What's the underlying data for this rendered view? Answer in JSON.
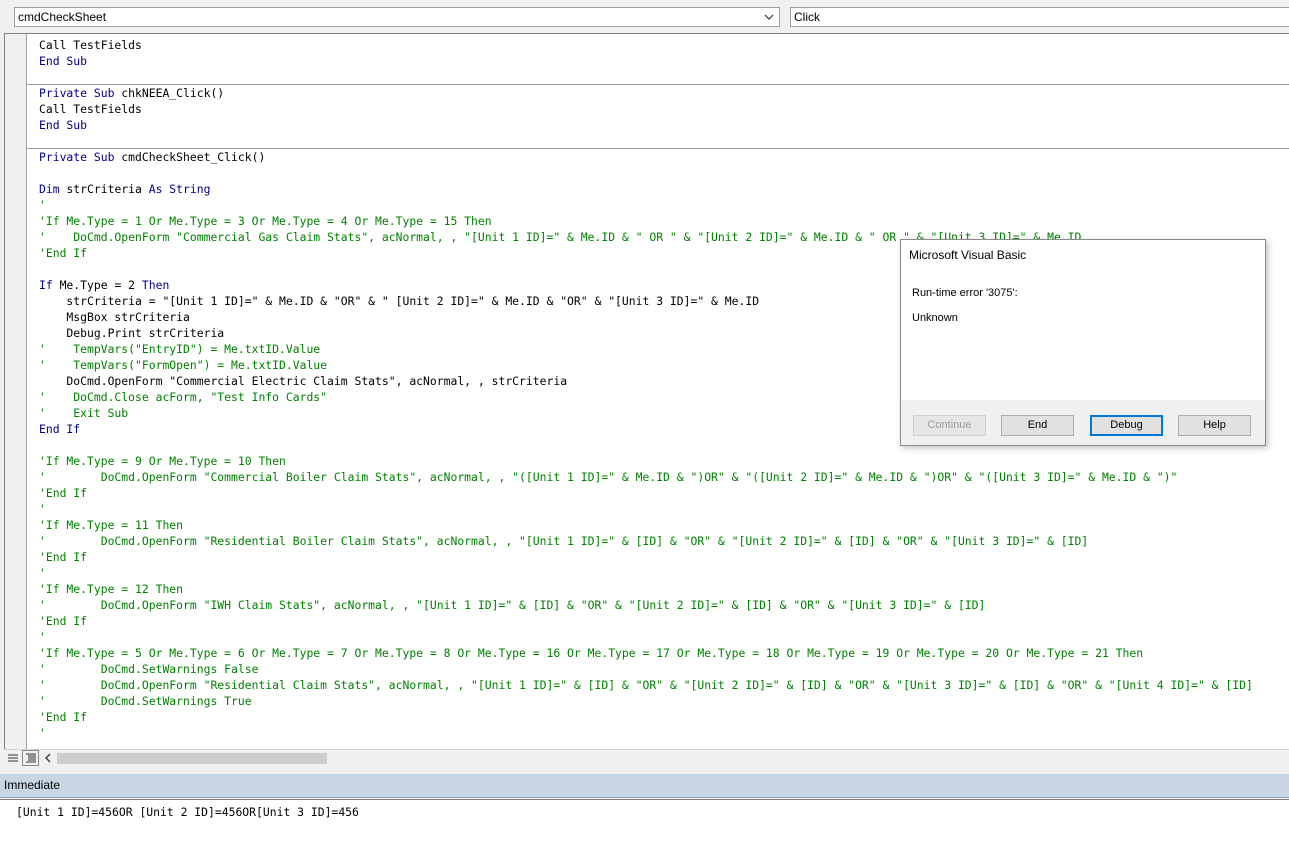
{
  "toolbar": {
    "object_combo": "cmdCheckSheet",
    "procedure_combo": "Click"
  },
  "code_lines": [
    [
      [
        "p",
        "Call TestFields"
      ]
    ],
    [
      [
        "k",
        "End Sub"
      ]
    ],
    [],
    [
      [
        "k",
        "Private Sub "
      ],
      [
        "p",
        "chkNEEA_Click()"
      ]
    ],
    [
      [
        "p",
        "Call TestFields"
      ]
    ],
    [
      [
        "k",
        "End Sub"
      ]
    ],
    [],
    [
      [
        "k",
        "Private Sub "
      ],
      [
        "p",
        "cmdCheckSheet_Click()"
      ]
    ],
    [],
    [
      [
        "k",
        "Dim "
      ],
      [
        "p",
        "strCriteria "
      ],
      [
        "k",
        "As String"
      ]
    ],
    [
      [
        "c",
        "'"
      ]
    ],
    [
      [
        "c",
        "'If Me.Type = 1 Or Me.Type = 3 Or Me.Type = 4 Or Me.Type = 15 Then"
      ]
    ],
    [
      [
        "c",
        "'    DoCmd.OpenForm \"Commercial Gas Claim Stats\", acNormal, , \"[Unit 1 ID]=\" & Me.ID & \" OR \" & \"[Unit 2 ID]=\" & Me.ID & \" OR \" & \"[Unit 3 ID]=\" & Me.ID"
      ]
    ],
    [
      [
        "c",
        "'End If"
      ]
    ],
    [],
    [
      [
        "k",
        "If "
      ],
      [
        "p",
        "Me.Type = 2 "
      ],
      [
        "k",
        "Then"
      ]
    ],
    [
      [
        "p",
        "    strCriteria = \"[Unit 1 ID]=\" & Me.ID & \"OR\" & \" [Unit 2 ID]=\" & Me.ID & \"OR\" & \"[Unit 3 ID]=\" & Me.ID"
      ]
    ],
    [
      [
        "p",
        "    MsgBox strCriteria"
      ]
    ],
    [
      [
        "p",
        "    Debug.Print strCriteria"
      ]
    ],
    [
      [
        "c",
        "'    TempVars(\"EntryID\") = Me.txtID.Value"
      ]
    ],
    [
      [
        "c",
        "'    TempVars(\"FormOpen\") = Me.txtID.Value"
      ]
    ],
    [
      [
        "p",
        "    DoCmd.OpenForm \"Commercial Electric Claim Stats\", acNormal, , strCriteria"
      ]
    ],
    [
      [
        "c",
        "'    DoCmd.Close acForm, \"Test Info Cards\""
      ]
    ],
    [
      [
        "c",
        "'    Exit Sub"
      ]
    ],
    [
      [
        "k",
        "End If"
      ]
    ],
    [],
    [
      [
        "c",
        "'If Me.Type = 9 Or Me.Type = 10 Then"
      ]
    ],
    [
      [
        "c",
        "'        DoCmd.OpenForm \"Commercial Boiler Claim Stats\", acNormal, , \"([Unit 1 ID]=\" & Me.ID & \")OR\" & \"([Unit 2 ID]=\" & Me.ID & \")OR\" & \"([Unit 3 ID]=\" & Me.ID & \")\""
      ]
    ],
    [
      [
        "c",
        "'End If"
      ]
    ],
    [
      [
        "c",
        "'"
      ]
    ],
    [
      [
        "c",
        "'If Me.Type = 11 Then"
      ]
    ],
    [
      [
        "c",
        "'        DoCmd.OpenForm \"Residential Boiler Claim Stats\", acNormal, , \"[Unit 1 ID]=\" & [ID] & \"OR\" & \"[Unit 2 ID]=\" & [ID] & \"OR\" & \"[Unit 3 ID]=\" & [ID]"
      ]
    ],
    [
      [
        "c",
        "'End If"
      ]
    ],
    [
      [
        "c",
        "'"
      ]
    ],
    [
      [
        "c",
        "'If Me.Type = 12 Then"
      ]
    ],
    [
      [
        "c",
        "'        DoCmd.OpenForm \"IWH Claim Stats\", acNormal, , \"[Unit 1 ID]=\" & [ID] & \"OR\" & \"[Unit 2 ID]=\" & [ID] & \"OR\" & \"[Unit 3 ID]=\" & [ID]"
      ]
    ],
    [
      [
        "c",
        "'End If"
      ]
    ],
    [
      [
        "c",
        "'"
      ]
    ],
    [
      [
        "c",
        "'If Me.Type = 5 Or Me.Type = 6 Or Me.Type = 7 Or Me.Type = 8 Or Me.Type = 16 Or Me.Type = 17 Or Me.Type = 18 Or Me.Type = 19 Or Me.Type = 20 Or Me.Type = 21 Then"
      ]
    ],
    [
      [
        "c",
        "'        DoCmd.SetWarnings False"
      ]
    ],
    [
      [
        "c",
        "'        DoCmd.OpenForm \"Residential Claim Stats\", acNormal, , \"[Unit 1 ID]=\" & [ID] & \"OR\" & \"[Unit 2 ID]=\" & [ID] & \"OR\" & \"[Unit 3 ID]=\" & [ID] & \"OR\" & \"[Unit 4 ID]=\" & [ID]"
      ]
    ],
    [
      [
        "c",
        "'        DoCmd.SetWarnings True"
      ]
    ],
    [
      [
        "c",
        "'End If"
      ]
    ],
    [
      [
        "c",
        "'"
      ]
    ]
  ],
  "separator_lines": [
    3,
    7
  ],
  "immediate": {
    "title": "Immediate",
    "output": "[Unit 1 ID]=456OR [Unit 2 ID]=456OR[Unit 3 ID]=456"
  },
  "dialog": {
    "title": "Microsoft Visual Basic",
    "message": "Run-time error '3075':",
    "detail": "Unknown",
    "buttons": {
      "continue": "Continue",
      "end": "End",
      "debug": "Debug",
      "help": "Help"
    }
  },
  "colors": {
    "keyword": "#00008b",
    "comment": "#008000",
    "focus_border": "#0078d7",
    "immediate_title_bg": "#c8d6e4"
  }
}
